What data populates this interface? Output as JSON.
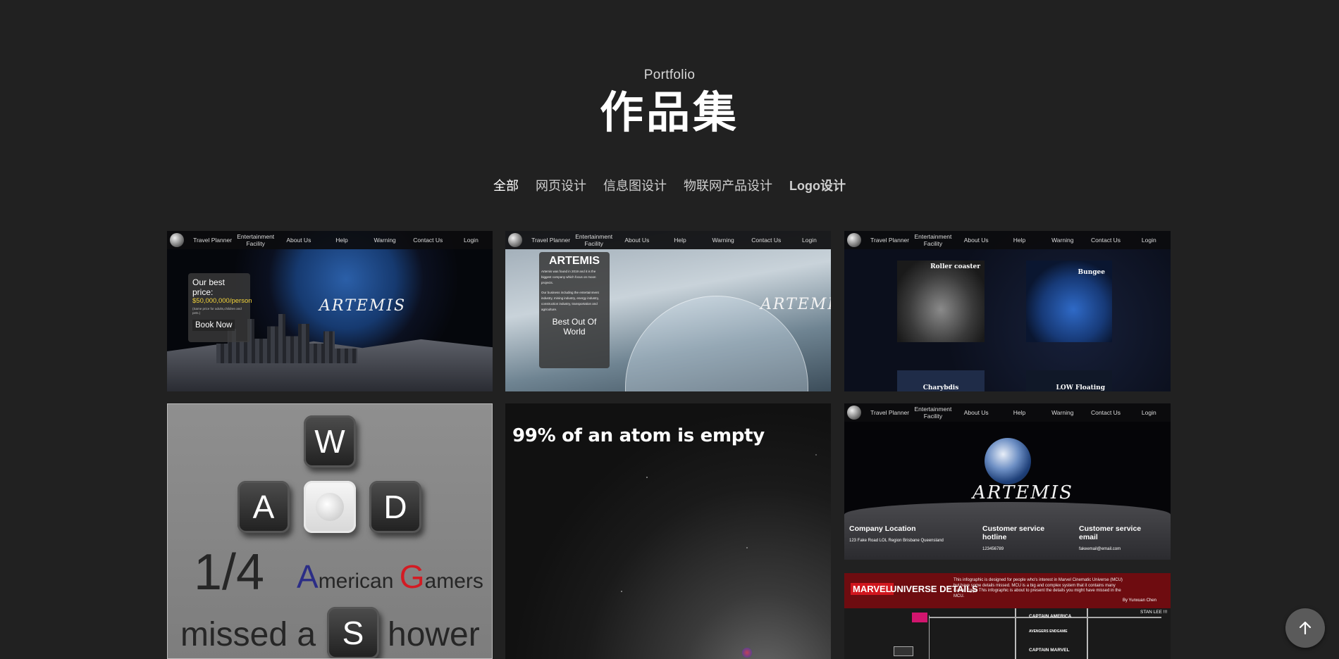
{
  "header": {
    "subtitle": "Portfolio",
    "title": "作品集"
  },
  "filters": [
    {
      "label": "全部",
      "active": true
    },
    {
      "label": "网页设计"
    },
    {
      "label": "信息图设计"
    },
    {
      "label": "物联网产品设计"
    },
    {
      "label": "Logo设计"
    }
  ],
  "site_nav": {
    "items": [
      "Travel Planner",
      "Entertainment Facility",
      "About Us",
      "Help",
      "Warning",
      "Contact Us",
      "Login"
    ]
  },
  "cards": {
    "card1": {
      "brand": "ARTEMIS",
      "price_line1": "Our best",
      "price_line2": "price:",
      "price_value": "$50,000,000/person",
      "price_note": "(Same price for adults,children and pets.)",
      "button": "Book Now"
    },
    "card2": {
      "brand": "ARTEMIS",
      "box_title": "ARTEMIS",
      "box_lines": [
        "Artemis was found in 2019 and it is the",
        "biggest company which focus on moon",
        "projects.",
        "Our business including the entertainment",
        "industry, mining industry, energy industry,",
        "construction industry, transportation and",
        "agriculture."
      ],
      "box_footer_line1": "Best Out Of",
      "box_footer_line2": "World"
    },
    "card3": {
      "items": [
        "Roller coaster",
        "Bungee",
        "Charybdis",
        "LOW Floating"
      ]
    },
    "card4": {
      "keys": [
        "W",
        "A",
        "D",
        "S"
      ],
      "fraction": "1/4",
      "a_letter": "A",
      "a_rest": "merican",
      "g_letter": "G",
      "g_rest": "amers",
      "missed": "missed a",
      "hower": "hower",
      "colors": {
        "a": "#2b2d86",
        "g": "#d31b23"
      }
    },
    "card5": {
      "headline": "99% of an atom is empty"
    },
    "card6": {
      "brand": "ARTEMIS",
      "col1_title": "Company Location",
      "col1_value": "123 Fake Road LOL Region Brisbane Queensland",
      "col2_title": "Customer service hotline",
      "col2_value": "123456789",
      "col3_title": "Customer service email",
      "col3_value": "fakeemail@email.com"
    },
    "card7": {
      "banner_logo": "MARVEL",
      "banner_title": "UNIVERSE DETAILS",
      "desc": "This infographic is designed for people who's interest in Marvel Cinematic Universe (MCU) but have some details missed. MCU is a big and complex system that it contains many Easter Eggs. This infographic is about to present the details you might have missed in the MCU.",
      "byline": "By Yunxuan Chen",
      "labels": [
        "CAPTAIN AMERICA",
        "AVENGERS ENDGAME",
        "CAPTAIN MARVEL",
        "STAN LEE !!!"
      ]
    }
  },
  "scroll_top": {
    "icon": "arrow-up-icon"
  }
}
